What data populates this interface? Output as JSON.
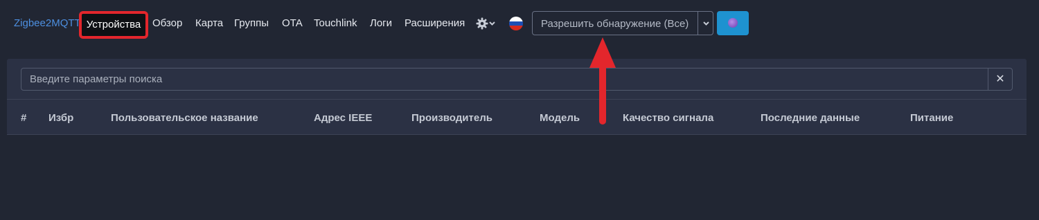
{
  "navbar": {
    "brand": "Zigbee2MQTT",
    "active_item": "Устройства",
    "items": [
      "Обзор",
      "Карта",
      "Группы",
      "OTA",
      "Touchlink",
      "Логи",
      "Расширения"
    ],
    "settings_icon": "gear-icon",
    "language_icon": "russian-flag-icon",
    "permit_join_label": "Разрешить обнаружение (Все)",
    "theme_icon": "theme-circle-icon"
  },
  "search": {
    "placeholder": "Введите параметры поиска",
    "clear_symbol": "✕"
  },
  "table": {
    "headers": [
      "#",
      "Избр",
      "Пользовательское название",
      "Адрес IEEE",
      "Производитель",
      "Модель",
      "Качество сигнала",
      "Последние данные",
      "Питание"
    ]
  },
  "colors": {
    "background": "#212633",
    "panel": "#2b3144",
    "brand": "#4d8fe0",
    "highlight": "#e3262c",
    "theme_button": "#1e92d0"
  }
}
